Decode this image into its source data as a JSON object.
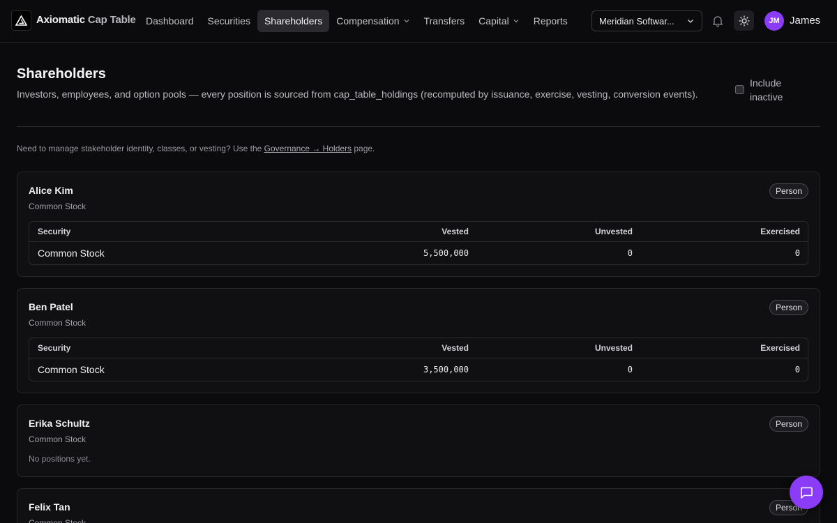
{
  "app": {
    "brand": "Axiomatic",
    "brand_sub": "Cap Table"
  },
  "nav": {
    "items": [
      {
        "label": "Dashboard",
        "active": false,
        "dropdown": false
      },
      {
        "label": "Securities",
        "active": false,
        "dropdown": false
      },
      {
        "label": "Shareholders",
        "active": true,
        "dropdown": false
      },
      {
        "label": "Compensation",
        "active": false,
        "dropdown": true
      },
      {
        "label": "Transfers",
        "active": false,
        "dropdown": false
      },
      {
        "label": "Capital",
        "active": false,
        "dropdown": true
      },
      {
        "label": "Reports",
        "active": false,
        "dropdown": false
      }
    ]
  },
  "header": {
    "org_selector": "Meridian Softwar...",
    "user_initials": "JM",
    "user_name": "James",
    "accent_color": "#8b3cf6"
  },
  "page": {
    "title": "Shareholders",
    "description": "Investors, employees, and option pools — every position is sourced from cap_table_holdings (recomputed by issuance, exercise, vesting, conversion events).",
    "include_inactive_label": "Include inactive",
    "include_inactive_checked": false,
    "notice_prefix": "Need to manage stakeholder identity, classes, or vesting? Use the ",
    "notice_link": "Governance → Holders",
    "notice_suffix": " page."
  },
  "table_columns": {
    "security": "Security",
    "vested": "Vested",
    "unvested": "Unvested",
    "exercised": "Exercised"
  },
  "holders": [
    {
      "name": "Alice Kim",
      "holder_class": "Common Stock",
      "type": "Person",
      "positions": [
        {
          "security": "Common Stock",
          "vested": "5,500,000",
          "unvested": "0",
          "exercised": "0"
        }
      ]
    },
    {
      "name": "Ben Patel",
      "holder_class": "Common Stock",
      "type": "Person",
      "positions": [
        {
          "security": "Common Stock",
          "vested": "3,500,000",
          "unvested": "0",
          "exercised": "0"
        }
      ]
    },
    {
      "name": "Erika Schultz",
      "holder_class": "Common Stock",
      "type": "Person",
      "empty_text": "No positions yet."
    },
    {
      "name": "Felix Tan",
      "holder_class": "Common Stock",
      "type": "Person"
    }
  ]
}
